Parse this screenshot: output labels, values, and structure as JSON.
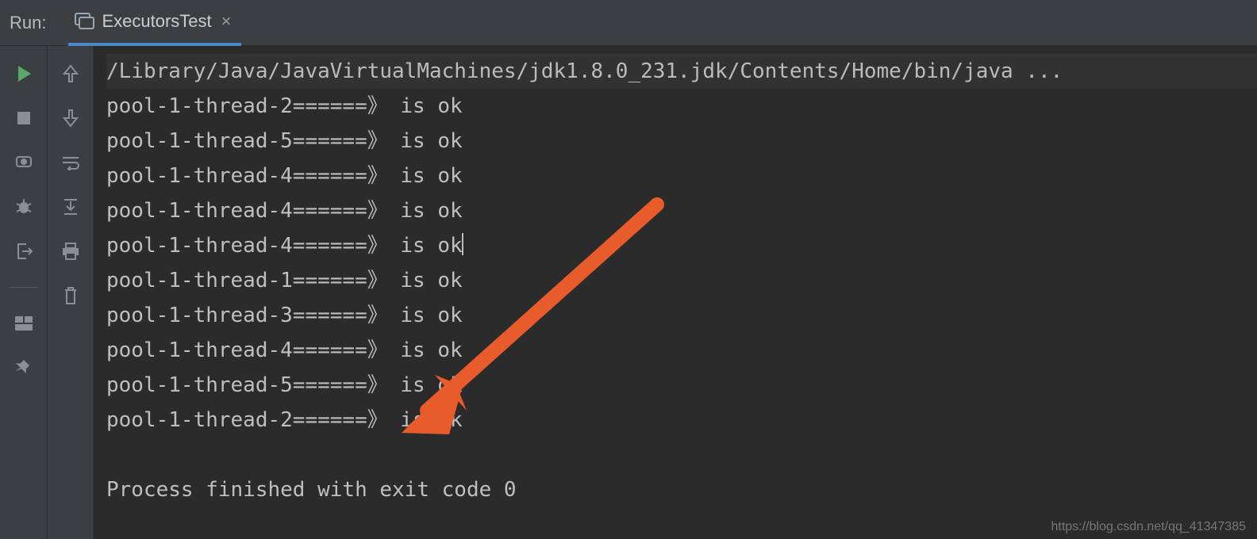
{
  "header": {
    "run_label": "Run:",
    "tab_label": "ExecutorsTest"
  },
  "console": {
    "cmd_line": "/Library/Java/JavaVirtualMachines/jdk1.8.0_231.jdk/Contents/Home/bin/java ...",
    "lines": [
      "pool-1-thread-2======》 is ok",
      "pool-1-thread-5======》 is ok",
      "pool-1-thread-4======》 is ok",
      "pool-1-thread-4======》 is ok",
      "pool-1-thread-4======》 is ok",
      "pool-1-thread-1======》 is ok",
      "pool-1-thread-3======》 is ok",
      "pool-1-thread-4======》 is ok",
      "pool-1-thread-5======》 is ok",
      "pool-1-thread-2======》 is ok"
    ],
    "exit_line": "Process finished with exit code 0"
  },
  "watermark": "https://blog.csdn.net/qq_41347385",
  "colors": {
    "run_green": "#59a869",
    "arrow_orange": "#e85b2a",
    "tab_underline": "#4a88c7"
  }
}
